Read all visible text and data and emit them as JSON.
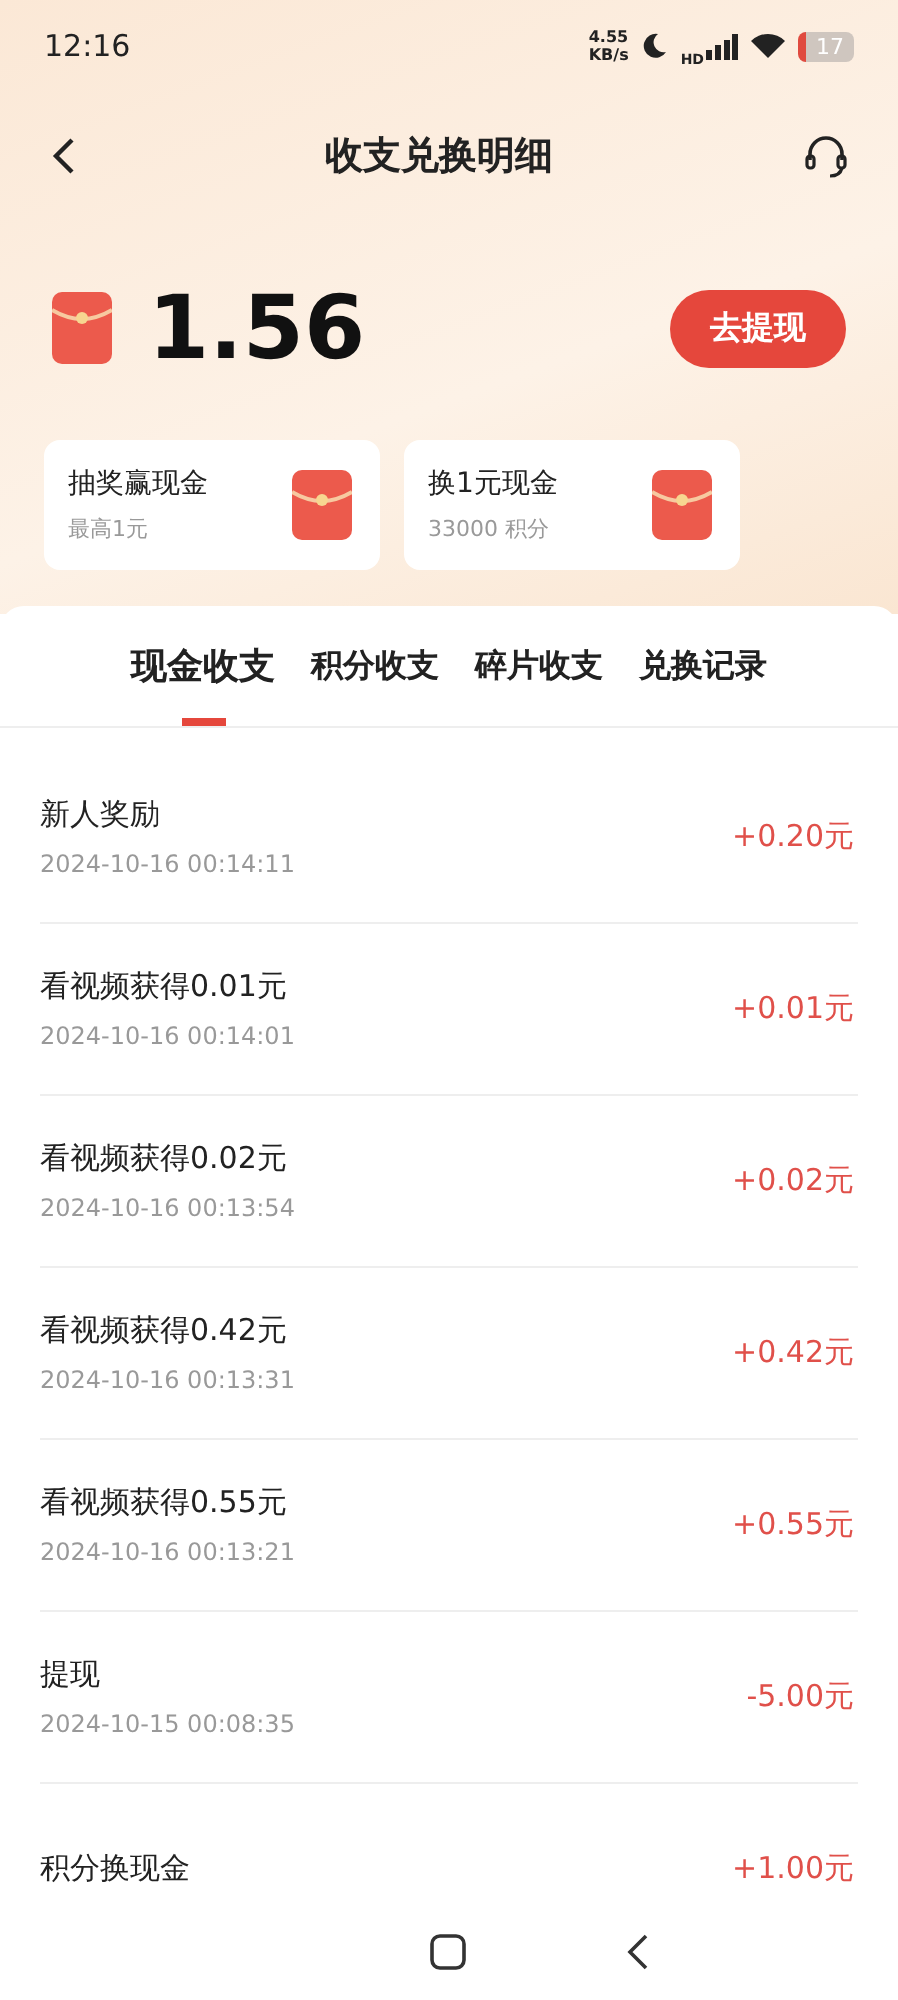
{
  "status_bar": {
    "time": "12:16",
    "net_speed_value": "4.55",
    "net_speed_unit": "KB/s",
    "signal_label": "HD",
    "battery": "17"
  },
  "header": {
    "title": "收支兑换明细"
  },
  "balance": {
    "amount": "1.56",
    "button": "去提现"
  },
  "promo_cards": [
    {
      "title": "抽奖赢现金",
      "subtitle": "最高1元"
    },
    {
      "title": "换1元现金",
      "subtitle": "33000 积分"
    }
  ],
  "tabs": [
    {
      "label": "现金收支",
      "selected": true
    },
    {
      "label": "积分收支",
      "selected": false
    },
    {
      "label": "碎片收支",
      "selected": false
    },
    {
      "label": "兑换记录",
      "selected": false
    }
  ],
  "records": [
    {
      "title": "新人奖励",
      "time": "2024-10-16 00:14:11",
      "amount": "+0.20元"
    },
    {
      "title": "看视频获得0.01元",
      "time": "2024-10-16 00:14:01",
      "amount": "+0.01元"
    },
    {
      "title": "看视频获得0.02元",
      "time": "2024-10-16 00:13:54",
      "amount": "+0.02元"
    },
    {
      "title": "看视频获得0.42元",
      "time": "2024-10-16 00:13:31",
      "amount": "+0.42元"
    },
    {
      "title": "看视频获得0.55元",
      "time": "2024-10-16 00:13:21",
      "amount": "+0.55元"
    },
    {
      "title": "提现",
      "time": "2024-10-15 00:08:35",
      "amount": "-5.00元"
    },
    {
      "title": "积分换现金",
      "amount": "+1.00元"
    }
  ]
}
